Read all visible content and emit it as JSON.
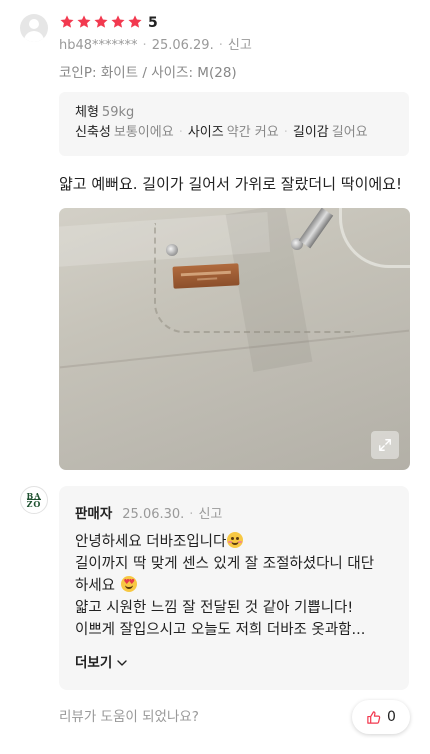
{
  "review": {
    "rating": 5,
    "rating_label": "5",
    "star_color": "#f2394f",
    "author": "hb48*******",
    "date": "25.06.29.",
    "report_label": "신고",
    "option": "코인P: 화이트 / 사이즈: M(28)",
    "body_info": {
      "build_label": "체형",
      "build_value": "59kg",
      "fit_items": [
        {
          "label": "신축성",
          "value": "보통이에요"
        },
        {
          "label": "사이즈",
          "value": "약간 커요"
        },
        {
          "label": "길이감",
          "value": "길어요"
        }
      ]
    },
    "text": "얇고 예뻐요. 길이가 길어서 가위로 잘랐더니 딱이에요!",
    "photo": {
      "expand_icon": "expand-icon"
    }
  },
  "seller_reply": {
    "logo_top": "BA",
    "logo_bottom": "ZO",
    "name": "판매자",
    "date": "25.06.30.",
    "report_label": "신고",
    "lines": [
      "안녕하세요 더바조입니다",
      "길이까지 딱 맞게 센스 있게 잘 조절하셨다니 대단",
      "하세요",
      "얇고 시원한 느낌 잘 전달된 것 같아 기쁩니다!",
      "이쁘게 잘입으시고 오늘도 저희 더바조 옷과함..."
    ],
    "more_label": "더보기"
  },
  "helpful": {
    "question": "리뷰가 도움이 되었나요?",
    "count": "0",
    "icon": "thumbs-up-icon",
    "accent": "#f2394f"
  }
}
